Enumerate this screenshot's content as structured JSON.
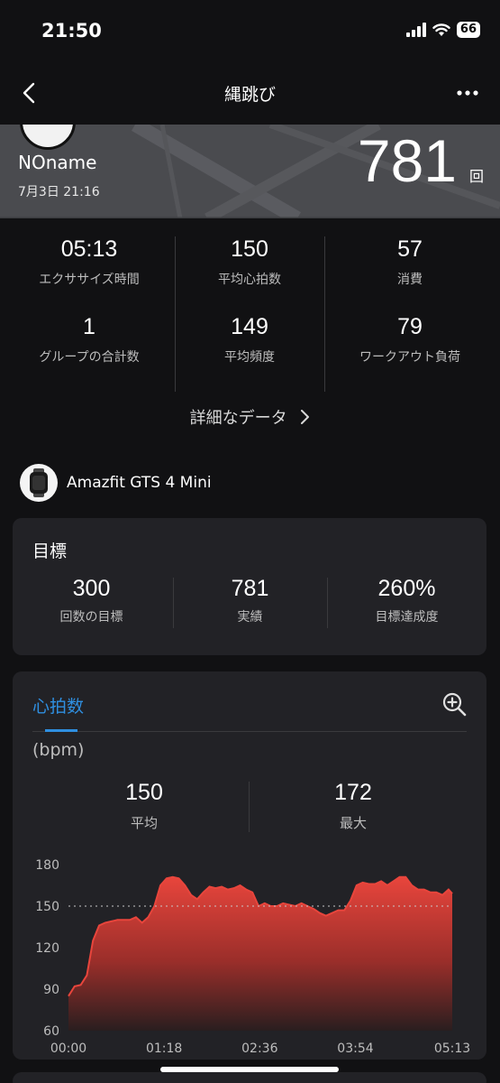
{
  "status_bar": {
    "time": "21:50",
    "battery": "66"
  },
  "nav": {
    "title": "縄跳び"
  },
  "hero": {
    "user_name": "NOname",
    "datetime": "7月3日 21:16",
    "count": "781",
    "count_unit": "回"
  },
  "stats": [
    {
      "value": "05:13",
      "label": "エクササイズ時間"
    },
    {
      "value": "150",
      "label": "平均心拍数"
    },
    {
      "value": "57",
      "label": "消費"
    },
    {
      "value": "1",
      "label": "グループの合計数"
    },
    {
      "value": "149",
      "label": "平均頻度"
    },
    {
      "value": "79",
      "label": "ワークアウト負荷"
    }
  ],
  "details_link": "詳細なデータ",
  "device": {
    "name": "Amazfit GTS 4 Mini"
  },
  "goal": {
    "title": "目標",
    "items": [
      {
        "value": "300",
        "label": "回数の目標"
      },
      {
        "value": "781",
        "label": "実績"
      },
      {
        "value": "260%",
        "label": "目標達成度"
      }
    ]
  },
  "heart_rate": {
    "tab": "心拍数",
    "unit": "(bpm)",
    "avg": {
      "value": "150",
      "label": "平均"
    },
    "max": {
      "value": "172",
      "label": "最大"
    }
  },
  "colors": {
    "accent": "#2f8fe0",
    "chart_line": "#e8453c"
  },
  "chart_data": {
    "type": "area",
    "title": "",
    "xlabel": "",
    "ylabel": "(bpm)",
    "ylim": [
      60,
      180
    ],
    "yticks": [
      180,
      150,
      120,
      90,
      60
    ],
    "xlim_seconds": [
      0,
      313
    ],
    "xticks": [
      "00:00",
      "01:18",
      "02:36",
      "03:54",
      "05:13"
    ],
    "reference_line": 150,
    "series": [
      {
        "x": [
          "00:00",
          "00:05",
          "00:10",
          "00:15",
          "00:20",
          "00:25",
          "00:30",
          "00:35",
          "00:40",
          "00:45",
          "00:50",
          "00:55",
          "01:00",
          "01:05",
          "01:10",
          "01:15",
          "01:20",
          "01:25",
          "01:30",
          "01:35",
          "01:40",
          "01:45",
          "01:50",
          "01:55",
          "02:00",
          "02:05",
          "02:10",
          "02:15",
          "02:20",
          "02:25",
          "02:30",
          "02:35",
          "02:40",
          "02:45",
          "02:50",
          "02:55",
          "03:00",
          "03:05",
          "03:10",
          "03:15",
          "03:20",
          "03:25",
          "03:30",
          "03:35",
          "03:40",
          "03:45",
          "03:50",
          "03:55",
          "04:00",
          "04:05",
          "04:10",
          "04:15",
          "04:20",
          "04:25",
          "04:30",
          "04:35",
          "04:40",
          "04:45",
          "04:50",
          "04:55",
          "05:00",
          "05:05",
          "05:10",
          "05:13"
        ],
        "values": [
          85,
          92,
          93,
          100,
          125,
          136,
          138,
          139,
          140,
          140,
          140,
          142,
          138,
          142,
          150,
          165,
          170,
          171,
          170,
          165,
          158,
          155,
          160,
          164,
          163,
          164,
          162,
          163,
          165,
          162,
          160,
          150,
          152,
          150,
          150,
          152,
          151,
          150,
          152,
          150,
          148,
          145,
          143,
          145,
          147,
          147,
          154,
          165,
          167,
          166,
          166,
          168,
          165,
          168,
          171,
          171,
          165,
          162,
          162,
          160,
          160,
          158,
          162,
          159
        ]
      }
    ]
  }
}
